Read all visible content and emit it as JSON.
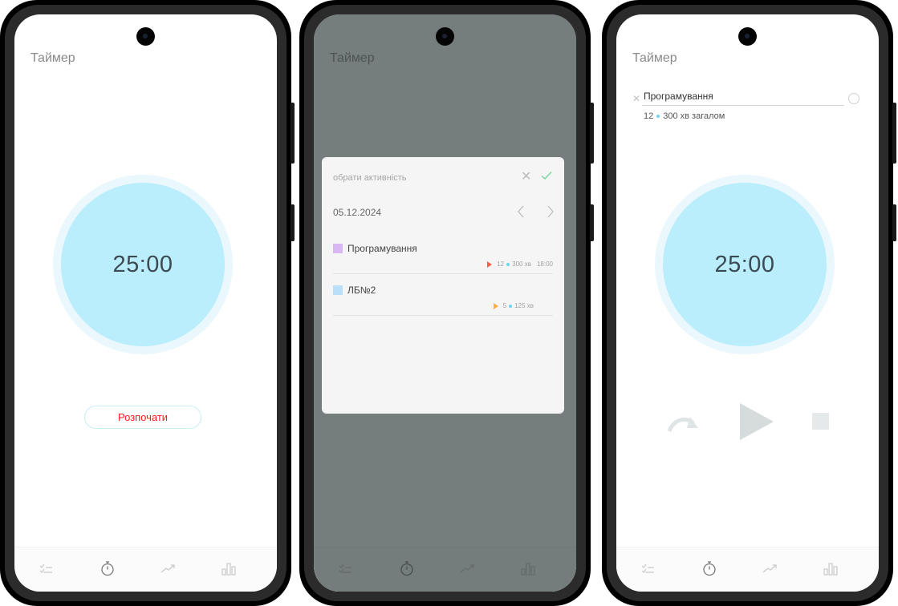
{
  "app": {
    "title": "Таймер"
  },
  "timer": {
    "display": "25:00"
  },
  "start_button": {
    "label": "Розпочати"
  },
  "nav": [
    "tasks-icon",
    "stopwatch-icon",
    "trend-icon",
    "stats-icon"
  ],
  "dialog": {
    "title": "обрати активність",
    "date": "05.12.2024",
    "activities": [
      {
        "name": "Програмування",
        "color": "#d7b8f3",
        "play_color": "#ff5b4a",
        "count": "12",
        "total": "300 хв",
        "time": "18:00"
      },
      {
        "name": "ЛБ№2",
        "color": "#b9dff9",
        "play_color": "#ffad3b",
        "count": "5",
        "total": "125 хв",
        "time": ""
      }
    ]
  },
  "selected": {
    "name": "Програмування",
    "count": "12",
    "summary": "300 хв загалом"
  },
  "colors": {
    "accent": "#baeefc",
    "danger": "#ff1a1a",
    "dot": "#6cd6ea"
  }
}
